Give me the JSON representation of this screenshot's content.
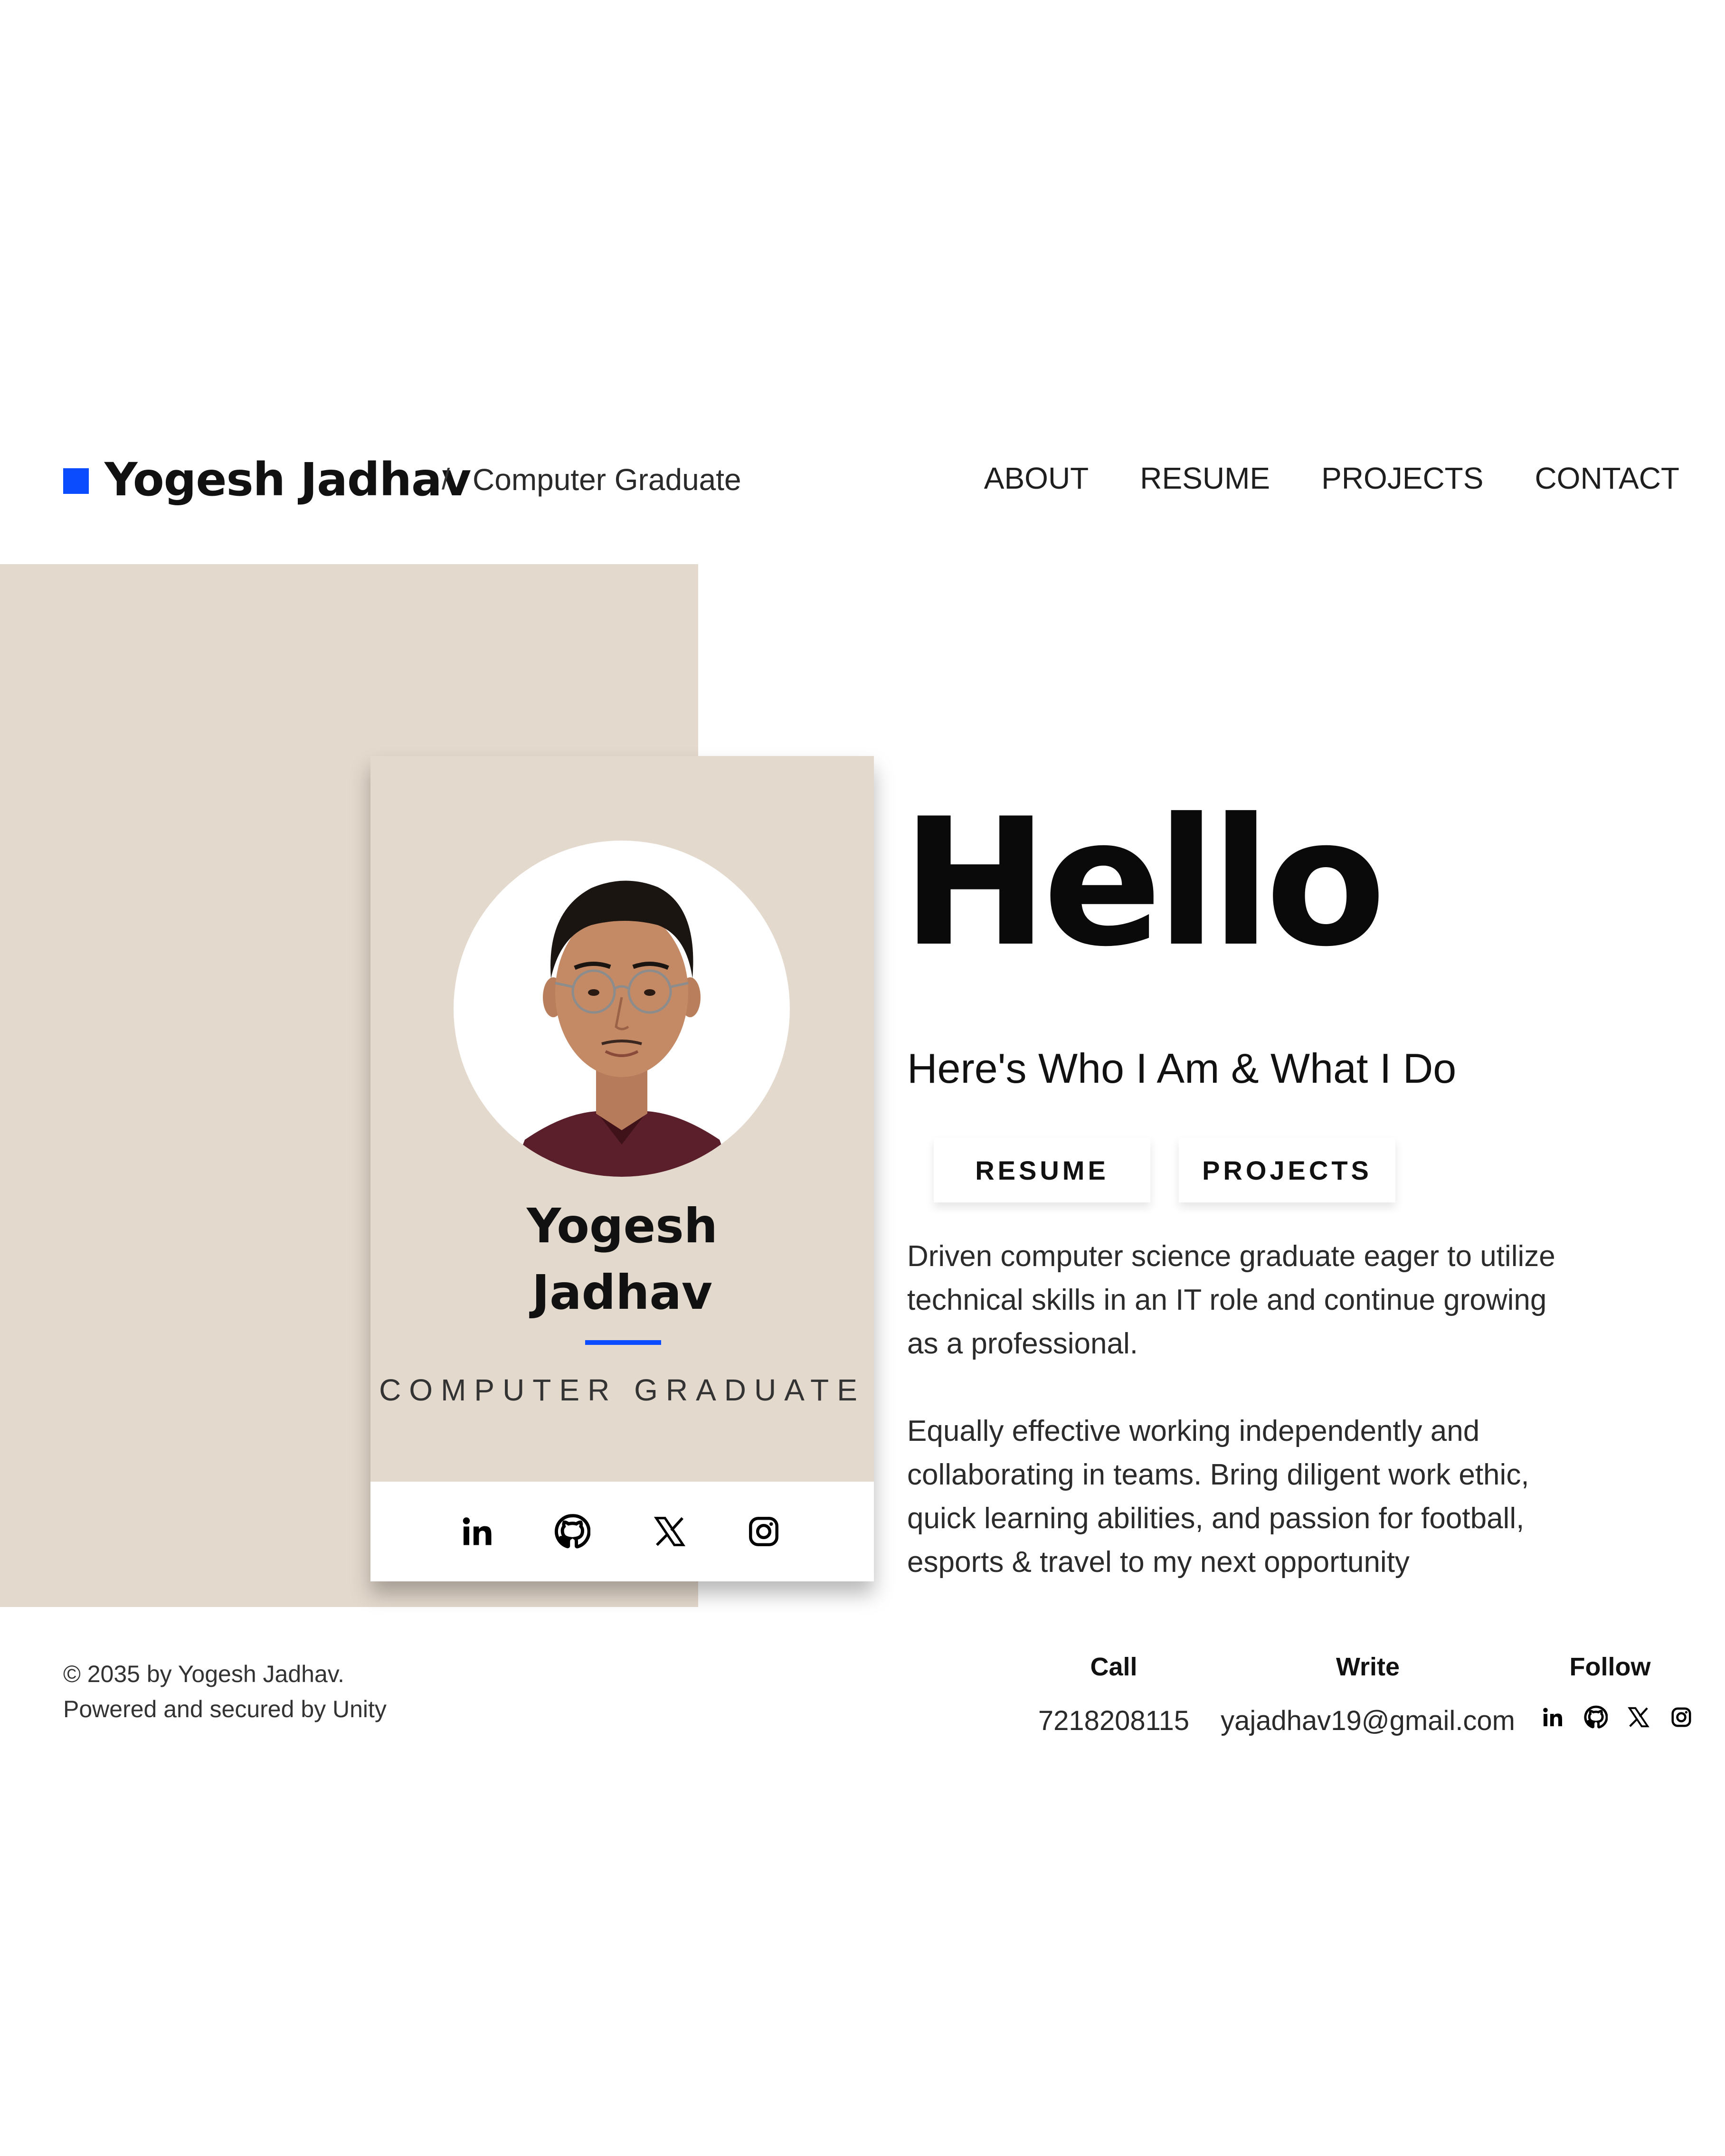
{
  "header": {
    "brand_name": "Yogesh Jadhav",
    "separator": "/",
    "tagline": "Computer Graduate",
    "accent_color": "#0b4cff",
    "nav": [
      {
        "label": "ABOUT"
      },
      {
        "label": "RESUME"
      },
      {
        "label": "PROJECTS"
      },
      {
        "label": "CONTACT"
      }
    ]
  },
  "card": {
    "name_first": "Yogesh",
    "name_last": "Jadhav",
    "role": "COMPUTER GRADUATE",
    "background_color": "#e4d9cd",
    "social_icons": [
      "linkedin-icon",
      "github-icon",
      "x-icon",
      "instagram-icon"
    ]
  },
  "hero": {
    "greeting": "Hello",
    "subheading": "Here's Who I Am & What I Do",
    "buttons": {
      "resume": "RESUME",
      "projects": "PROJECTS"
    },
    "paragraph_1": "Driven computer science graduate eager to utilize technical skills in an IT role and continue growing as a professional.",
    "paragraph_2": "Equally effective working independently and collaborating in teams. Bring diligent work ethic, quick learning abilities, and passion for football, esports & travel to my next opportunity"
  },
  "footer": {
    "copyright_line_1": "© 2035 by Yogesh Jadhav.",
    "copyright_line_2": "Powered and secured by Unity",
    "call": {
      "heading": "Call",
      "value": "7218208115"
    },
    "write": {
      "heading": "Write",
      "value": "yajadhav19@gmail.com"
    },
    "follow": {
      "heading": "Follow",
      "icons": [
        "linkedin-icon",
        "github-icon",
        "x-icon",
        "instagram-icon"
      ]
    }
  }
}
